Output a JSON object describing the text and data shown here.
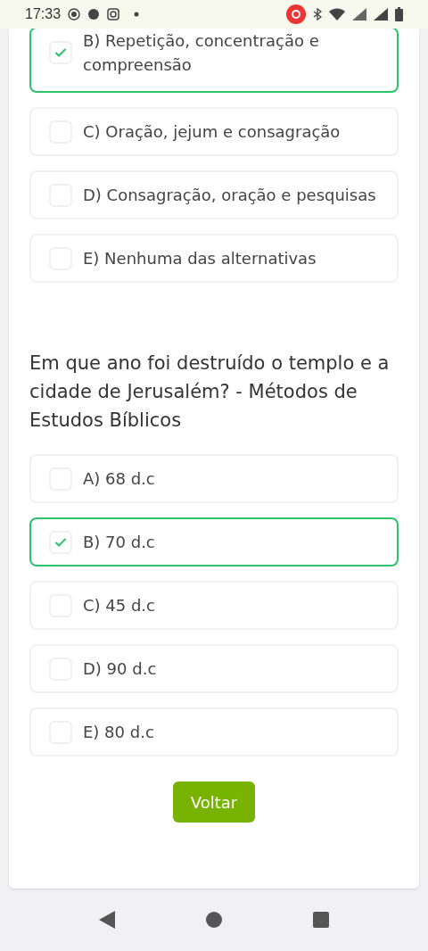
{
  "status_bar": {
    "time": "17:33"
  },
  "questions": [
    {
      "options": [
        {
          "label": "B) Repetição, concentração e compreensão",
          "selected": true
        },
        {
          "label": "C) Oração, jejum e consagração",
          "selected": false
        },
        {
          "label": "D) Consagração, oração e pesquisas",
          "selected": false
        },
        {
          "label": "E) Nenhuma das alternativas",
          "selected": false
        }
      ]
    },
    {
      "text": "Em que ano foi destruído o templo e a cidade de Jerusalém? - Métodos de Estudos Bíblicos",
      "options": [
        {
          "label": "A) 68 d.c",
          "selected": false
        },
        {
          "label": "B) 70 d.c",
          "selected": true
        },
        {
          "label": "C) 45 d.c",
          "selected": false
        },
        {
          "label": "D) 90 d.c",
          "selected": false
        },
        {
          "label": "E) 80 d.c",
          "selected": false
        }
      ]
    }
  ],
  "back_button": "Voltar"
}
